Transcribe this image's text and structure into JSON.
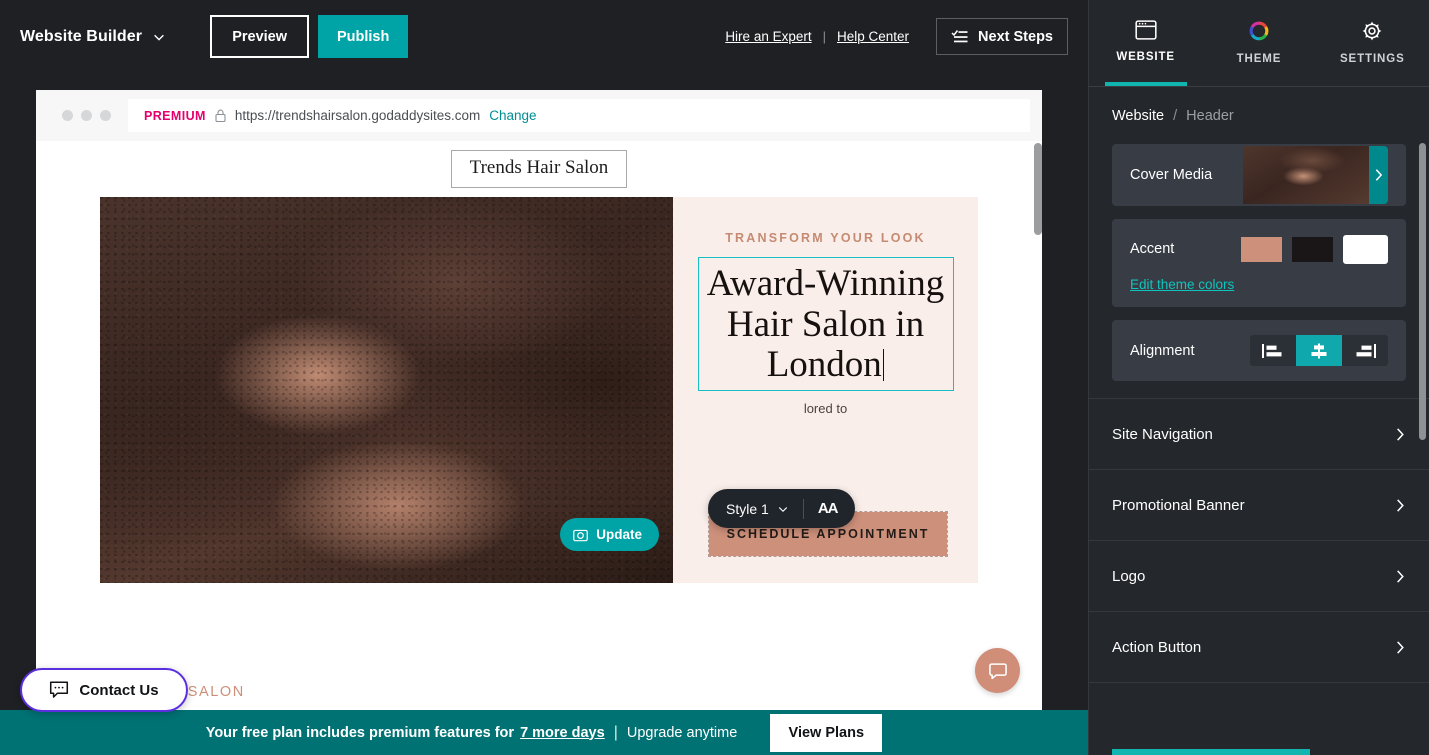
{
  "topbar": {
    "brand": "Website Builder",
    "brand_caret": "chevron-down-icon",
    "preview": "Preview",
    "publish": "Publish",
    "hire_expert": "Hire an Expert",
    "separator": "|",
    "help_center": "Help Center",
    "next_steps": "Next Steps"
  },
  "canvas": {
    "urlbar": {
      "premium": "PREMIUM",
      "lock": "lock-icon",
      "url": "https://trendshairsalon.godaddysites.com",
      "change": "Change"
    },
    "site": {
      "title": "Trends Hair Salon",
      "eyebrow": "TRANSFORM YOUR LOOK",
      "headline": "Award-Winning Hair Salon in London",
      "subtext": "lored to",
      "cta": "SCHEDULE APPOINTMENT",
      "update_button": "Update",
      "footer_strip": "NDS HAIR SALON"
    },
    "style_toolbar": {
      "style": "Style 1",
      "font_size_icon": "AA"
    }
  },
  "contact_fab": {
    "label": "Contact Us"
  },
  "bottom_banner": {
    "text_before": "Your free plan includes premium features for",
    "days_link": "7 more days",
    "separator": "|",
    "text_after": "Upgrade anytime",
    "view_plans": "View Plans"
  },
  "panel": {
    "tabs": [
      {
        "label": "WEBSITE",
        "icon": "window-icon",
        "active": true
      },
      {
        "label": "THEME",
        "icon": "color-wheel-icon",
        "active": false
      },
      {
        "label": "SETTINGS",
        "icon": "gear-icon",
        "active": false
      }
    ],
    "breadcrumb": {
      "root": "Website",
      "sep": "/",
      "current": "Header"
    },
    "cover_media": {
      "label": "Cover Media",
      "arrow": "chevron-right-icon"
    },
    "accent": {
      "label": "Accent",
      "edit_link": "Edit theme colors",
      "swatches": [
        {
          "name": "accent-salmon",
          "color": "#cd907a",
          "selected": false
        },
        {
          "name": "accent-black",
          "color": "#1a1618",
          "selected": false
        },
        {
          "name": "accent-white",
          "color": "#ffffff",
          "selected": true
        }
      ]
    },
    "alignment": {
      "label": "Alignment",
      "options": [
        {
          "name": "align-left",
          "active": false
        },
        {
          "name": "align-center",
          "active": true
        },
        {
          "name": "align-right",
          "active": false
        }
      ]
    },
    "rows": [
      {
        "label": "Site Navigation"
      },
      {
        "label": "Promotional Banner"
      },
      {
        "label": "Logo"
      },
      {
        "label": "Action Button"
      }
    ]
  },
  "colors": {
    "teal": "#00a4a6",
    "banner_teal": "#017274",
    "pink": "#e6006e",
    "accent_salmon": "#cd907a",
    "panel_bg": "#24272b",
    "card_bg": "#383c45",
    "purple": "#5b2fe0"
  }
}
